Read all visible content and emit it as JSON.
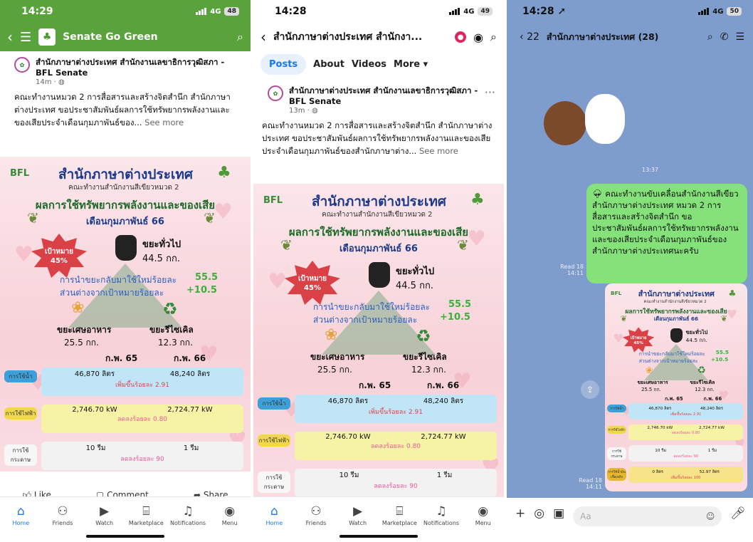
{
  "p1": {
    "time": "14:29",
    "network": "4G",
    "battery": "48",
    "group_name": "Senate Go Green",
    "post": {
      "author": "สำนักภาษาต่างประเทศ สำนักงานเลขาธิการวุฒิสภา - BFL Senate",
      "time": "14m · ◍",
      "text": "คณะทำงานหมวด 2 การสื่อสารและสร้างจิตสำนึก สำนักภาษาต่างประเทศ ขอประชาสัมพันธ์ผลการใช้ทรัพยากรพลังงานและของเสียประจำเดือนกุมภาพันธ์ของ...",
      "see_more": "See more"
    },
    "actions": {
      "like": "Like",
      "comment": "Comment",
      "share": "Share"
    }
  },
  "p2": {
    "time": "14:28",
    "network": "4G",
    "battery": "49",
    "page_title": "สำนักภาษาต่างประเทศ สำนักงา...",
    "tabs": [
      "Posts",
      "About",
      "Videos",
      "More ▾"
    ],
    "post": {
      "author": "สำนักภาษาต่างประเทศ สำนักงานเลขาธิการวุฒิสภา - BFL Senate",
      "time": "13m · ◍",
      "text": "คณะทำงานหมวด 2 การสื่อสารและสร้างจิตสำนึก สำนักภาษาต่างประเทศ ขอประชาสัมพันธ์ผลการใช้ทรัพยากรพลังงานและของเสียประจำเดือนกุมภาพันธ์ของสำนักภาษาต่าง...",
      "see_more": "See more"
    }
  },
  "poster": {
    "logo": "BFL",
    "title": "สำนักภาษาต่างประเทศ",
    "subtitle": "คณะทำงานสำนักงานสีเขียวหมวด 2",
    "heading": "ผลการใช้ทรัพยากรพลังงานและของเสีย",
    "month": "เดือนกุมภาพันธ์ 66",
    "target_label": "เป้าหมาย",
    "target_value": "45%",
    "general_waste_label": "ขยะทั่วไป",
    "general_waste_value": "44.5 กก.",
    "recycle_text_label": "การนำขยะกลับมาใช้ใหม่ร้อยละ",
    "recycle_text_value": "55.5",
    "diff_label": "ส่วนต่างจากเป้าหมายร้อยละ",
    "diff_value": "+10.5",
    "food_waste_label": "ขยะเศษอาหาร",
    "food_waste_value": "25.5 กก.",
    "recycle_waste_label": "ขยะรีไซเคิล",
    "recycle_waste_value": "12.3 กก.",
    "col1": "ก.พ. 65",
    "col2": "ก.พ. 66",
    "rows": [
      {
        "tag": "การใช้น้ำ",
        "v1": "46,870 ลิตร",
        "v2": "48,240 ลิตร",
        "note": "เพิ่มขึ้นร้อยละ 2.91",
        "color": "#bfe5f7",
        "tagcolor": "#3da0d8",
        "notecolor": "#e0454b"
      },
      {
        "tag": "การใช้ไฟฟ้า",
        "v1": "2,746.70 kW",
        "v2": "2,724.77 kW",
        "note": "ลดลงร้อยละ 0.80",
        "color": "#f7f3a6",
        "tagcolor": "#f0d84a",
        "notecolor": "#e85a9a"
      },
      {
        "tag": "การใช้กระดาษ",
        "v1": "10 รีม",
        "v2": "1 รีม",
        "note": "ลดลงร้อยละ 90",
        "color": "#f2f2f2",
        "tagcolor": "#f7f7f7",
        "notecolor": "#e85a9a"
      },
      {
        "tag": "การใช้น้ำมันเชื้อเพลิง",
        "v1": "0 ลิตร",
        "v2": "52.97 ลิตร",
        "note": "เพิ่มขึ้นร้อยละ 100",
        "color": "#f7e38a",
        "tagcolor": "#e5b832",
        "notecolor": "#e0454b"
      }
    ]
  },
  "tabbar": [
    "Home",
    "Friends",
    "Watch",
    "Marketplace",
    "Notifications",
    "Menu"
  ],
  "p3": {
    "time": "14:28",
    "network": "4G",
    "battery": "50",
    "back_count": "22",
    "chat_title": "สำนักภาษาต่างประเทศ (28)",
    "sticker_time": "13:37",
    "message": "คณะทำงานขับเคลื่อนสำนักงานสีเขียว สำนักภาษาต่างประเทศ หมวด 2 การสื่อสารและสร้างจิตสำนึก ขอประชาสัมพันธ์ผลการใช้ทรัพยากรพลังงานและของเสียประจำเดือนกุมภาพันธ์ของสำนักภาษาต่างประเทศนะครับ",
    "read1": "Read 18",
    "time1": "14:11",
    "read2": "Read 18",
    "time2": "14:11",
    "input_placeholder": "Aa"
  }
}
